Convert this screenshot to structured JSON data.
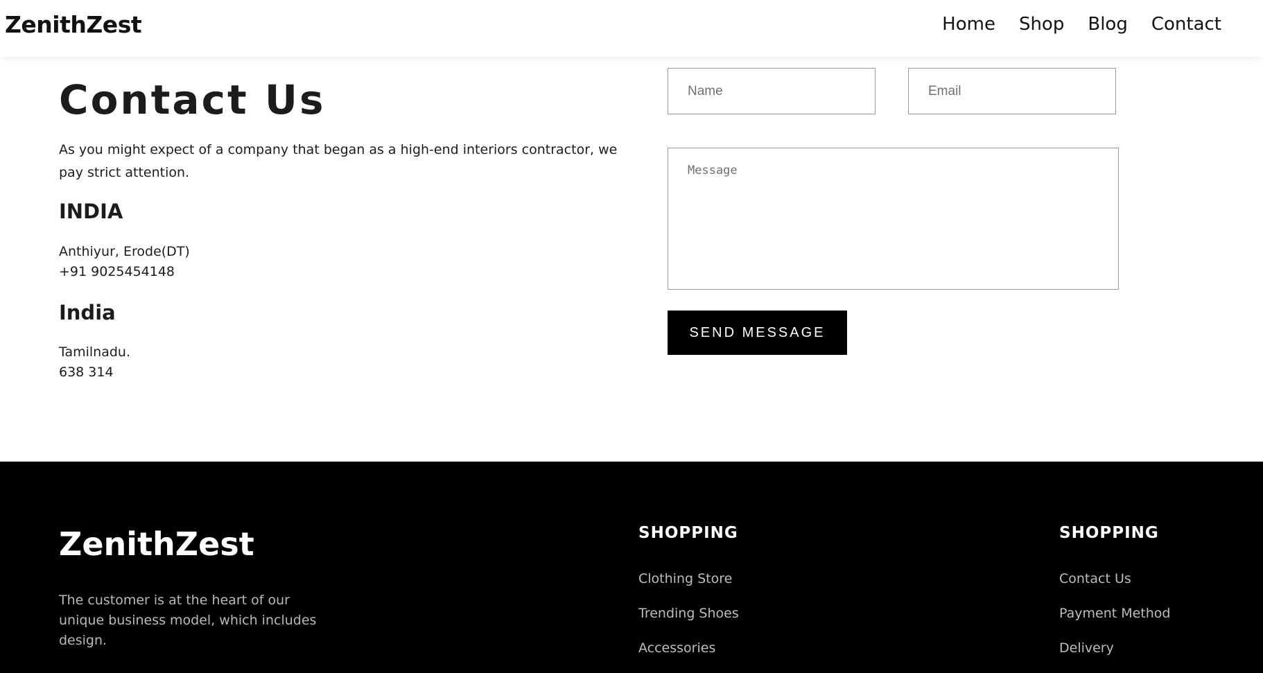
{
  "header": {
    "brand": "ZenithZest",
    "nav": [
      "Home",
      "Shop",
      "Blog",
      "Contact"
    ]
  },
  "contact": {
    "title": "Contact Us",
    "intro": "As you might expect of a company that began as a high-end interiors contractor, we pay strict attention.",
    "locations": [
      {
        "heading": "INDIA",
        "lines": [
          "Anthiyur, Erode(DT)",
          "+91 9025454148"
        ]
      },
      {
        "heading": "India",
        "lines": [
          "Tamilnadu.",
          "638 314"
        ]
      }
    ]
  },
  "form": {
    "name_placeholder": "Name",
    "email_placeholder": "Email",
    "message_placeholder": "Message",
    "send_label": "SEND MESSAGE"
  },
  "footer": {
    "brand": "ZenithZest",
    "tagline": "The customer is at the heart of our unique business model, which includes design.",
    "columns": [
      {
        "title": "SHOPPING",
        "links": [
          "Clothing Store",
          "Trending Shoes",
          "Accessories"
        ]
      },
      {
        "title": "SHOPPING",
        "links": [
          "Contact Us",
          "Payment Method",
          "Delivery"
        ]
      }
    ]
  }
}
